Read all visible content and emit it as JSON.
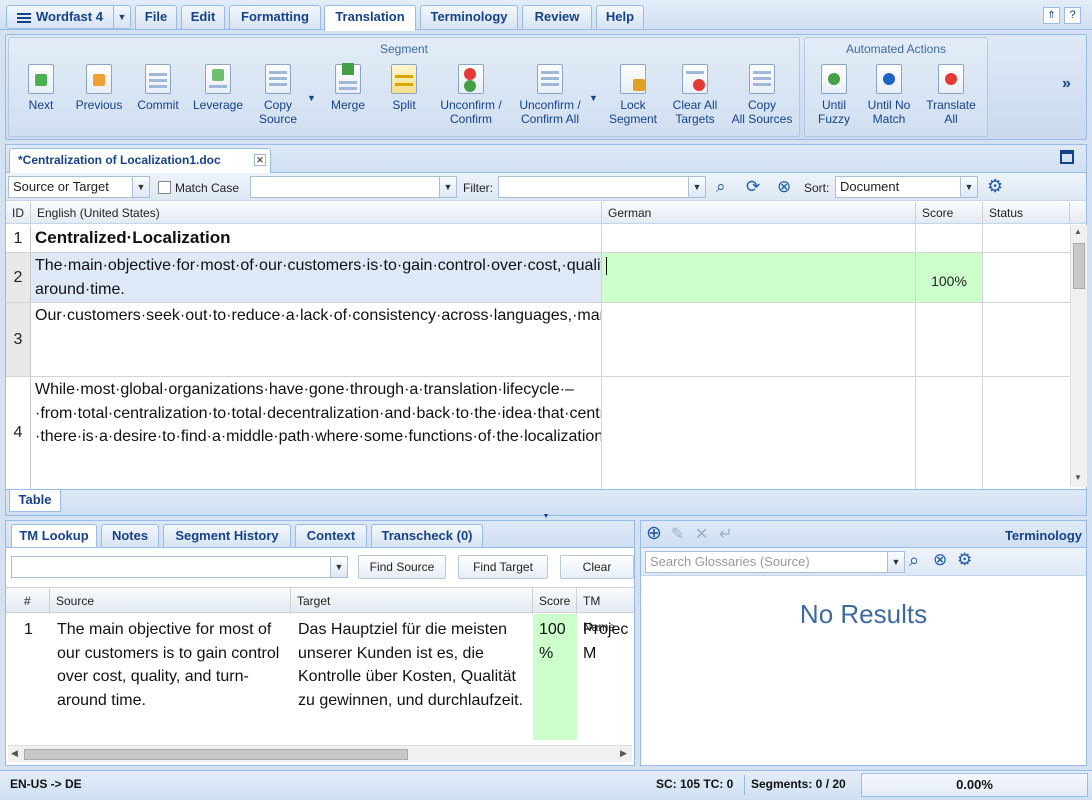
{
  "app": {
    "title": "Wordfast 4"
  },
  "menu": {
    "tabs": [
      "File",
      "Edit",
      "Formatting",
      "Translation",
      "Terminology",
      "Review",
      "Help"
    ],
    "active": "Translation"
  },
  "ribbon": {
    "segment_group_title": "Segment",
    "automated_group_title": "Automated Actions",
    "buttons": [
      {
        "line1": "Next",
        "line2": ""
      },
      {
        "line1": "Previous",
        "line2": ""
      },
      {
        "line1": "Commit",
        "line2": ""
      },
      {
        "line1": "Leverage",
        "line2": ""
      },
      {
        "line1": "Copy",
        "line2": "Source"
      },
      {
        "line1": "Merge",
        "line2": ""
      },
      {
        "line1": "Split",
        "line2": ""
      },
      {
        "line1": "Unconfirm /",
        "line2": "Confirm"
      },
      {
        "line1": "Unconfirm /",
        "line2": "Confirm All"
      },
      {
        "line1": "Lock",
        "line2": "Segment"
      },
      {
        "line1": "Clear All",
        "line2": "Targets"
      },
      {
        "line1": "Copy",
        "line2": "All Sources"
      }
    ],
    "auto_buttons": [
      {
        "line1": "Until",
        "line2": "Fuzzy"
      },
      {
        "line1": "Until No",
        "line2": "Match"
      },
      {
        "line1": "Translate",
        "line2": "All"
      }
    ],
    "more": "»"
  },
  "document": {
    "tab_title": "*Centralization of Localization1.doc",
    "filter": {
      "scope": "Source or Target",
      "match_case": "Match Case",
      "filter_label": "Filter:",
      "sort_label": "Sort:",
      "sort_value": "Document"
    },
    "columns": {
      "id": "ID",
      "source": "English (United States)",
      "target": "German",
      "score": "Score",
      "status": "Status"
    },
    "rows": [
      {
        "id": "1",
        "source": "Centralized·Localization",
        "target": "",
        "score": ""
      },
      {
        "id": "2",
        "source": "The·main·objective·for·most·of·our·customers·is·to·gain·control·over·cost,·quality,·and·turn-around·time.",
        "target": "",
        "score": "100%"
      },
      {
        "id": "3",
        "source": "Our·customers·seek·out·to·reduce·a·lack·of·consistency·across·languages,·markets·and·programs,·a·lack·of·cost·control·over·the·same,·and·significant·delays·in·launching·global·initiatives.",
        "target": "",
        "score": ""
      },
      {
        "id": "4",
        "source": "While·most·global·organizations·have·gone·through·a·translation·lifecycle·–·from·total·centralization·to·total·decentralization·and·back·to·the·idea·that·centralization·provides·the·highest·benefits·–·there·is·a·desire·to·find·a·middle·path·where·some·functions·of·the·localization·process·must·be·centralized·while·others·can·take·place·",
        "target": "",
        "score": ""
      }
    ],
    "bottom_tab": "Table"
  },
  "tm_panel": {
    "tabs": [
      "TM Lookup",
      "Notes",
      "Segment History",
      "Context",
      "Transcheck (0)"
    ],
    "buttons": {
      "find_source": "Find Source",
      "find_target": "Find Target",
      "clear": "Clear"
    },
    "columns": {
      "num": "#",
      "source": "Source",
      "target": "Target",
      "score": "Score",
      "tm_name": "TM Name"
    },
    "result": {
      "num": "1",
      "source": "The main objective for most of our customers is to gain control over cost, quality, and turn-around time.",
      "target": "Das Hauptziel für die meisten unserer Kunden ist es, die Kontrolle über Kosten, Qualität zu gewinnen, und durchlaufzeit.",
      "score": "100 %",
      "tm_name": "Projec M"
    }
  },
  "terminology": {
    "title": "Terminology",
    "search_placeholder": "Search Glossaries (Source)",
    "no_results": "No Results"
  },
  "status": {
    "lang": "EN-US -> DE",
    "sc_tc": "SC: 105 TC: 0",
    "segments": "Segments: 0 / 20",
    "progress": "0.00%"
  },
  "colors": {
    "accent": "#15428b",
    "target_highlight": "#ccffcc",
    "selected_row": "#dfe8f6"
  }
}
